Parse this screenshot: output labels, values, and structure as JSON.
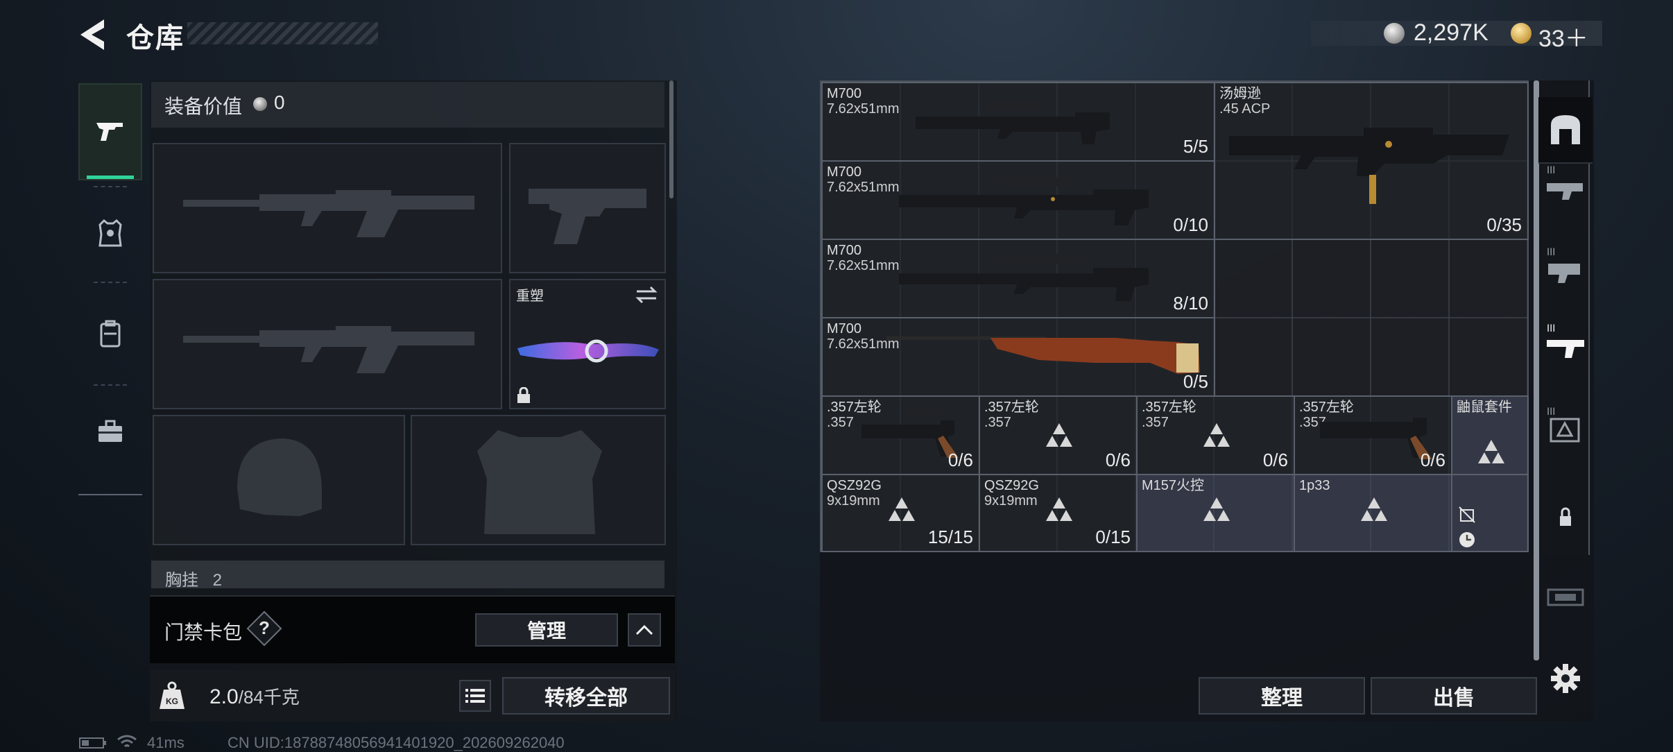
{
  "header": {
    "title": "仓库",
    "silver_amount": "2,297K",
    "gold_amount": "33＋"
  },
  "loadout": {
    "value_label": "装备价值",
    "value_amount": "0",
    "knife_label": "重塑",
    "cutoff_label": "胸挂",
    "cutoff_count": "2"
  },
  "keycard": {
    "label": "门禁卡包",
    "help": "?",
    "manage": "管理"
  },
  "weight": {
    "current": "2.0",
    "max": "/84千克",
    "transfer_all": "转移全部"
  },
  "status": {
    "ping": "41ms",
    "uid": "CN UID:18788748056941401920_202609262040"
  },
  "stash": {
    "items": [
      {
        "name": "M700",
        "caliber": "7.62x51mm",
        "count": "5/5"
      },
      {
        "name": "汤姆逊",
        "caliber": ".45 ACP",
        "count": ""
      },
      {
        "name": "M700",
        "caliber": "7.62x51mm",
        "count": "0/10"
      },
      {
        "name": "",
        "caliber": "",
        "count": "0/35"
      },
      {
        "name": "M700",
        "caliber": "7.62x51mm",
        "count": "8/10"
      },
      {
        "name": "M700",
        "caliber": "7.62x51mm",
        "count": "0/5"
      },
      {
        "name": ".357左轮",
        "caliber": ".357",
        "count": "0/6"
      },
      {
        "name": ".357左轮",
        "caliber": ".357",
        "count": "0/6"
      },
      {
        "name": ".357左轮",
        "caliber": ".357",
        "count": "0/6"
      },
      {
        "name": ".357左轮",
        "caliber": ".357",
        "count": "0/6"
      },
      {
        "name": "鼬鼠套件",
        "caliber": "",
        "count": ""
      },
      {
        "name": "QSZ92G",
        "caliber": "9x19mm",
        "count": "15/15"
      },
      {
        "name": "QSZ92G",
        "caliber": "9x19mm",
        "count": "0/15"
      },
      {
        "name": "M157火控",
        "caliber": "",
        "count": ""
      },
      {
        "name": "1p33",
        "caliber": "",
        "count": ""
      }
    ],
    "organize": "整理",
    "sell": "出售"
  },
  "colors": {
    "accent_green": "#2fd49a",
    "item_purple": "#464a62"
  }
}
